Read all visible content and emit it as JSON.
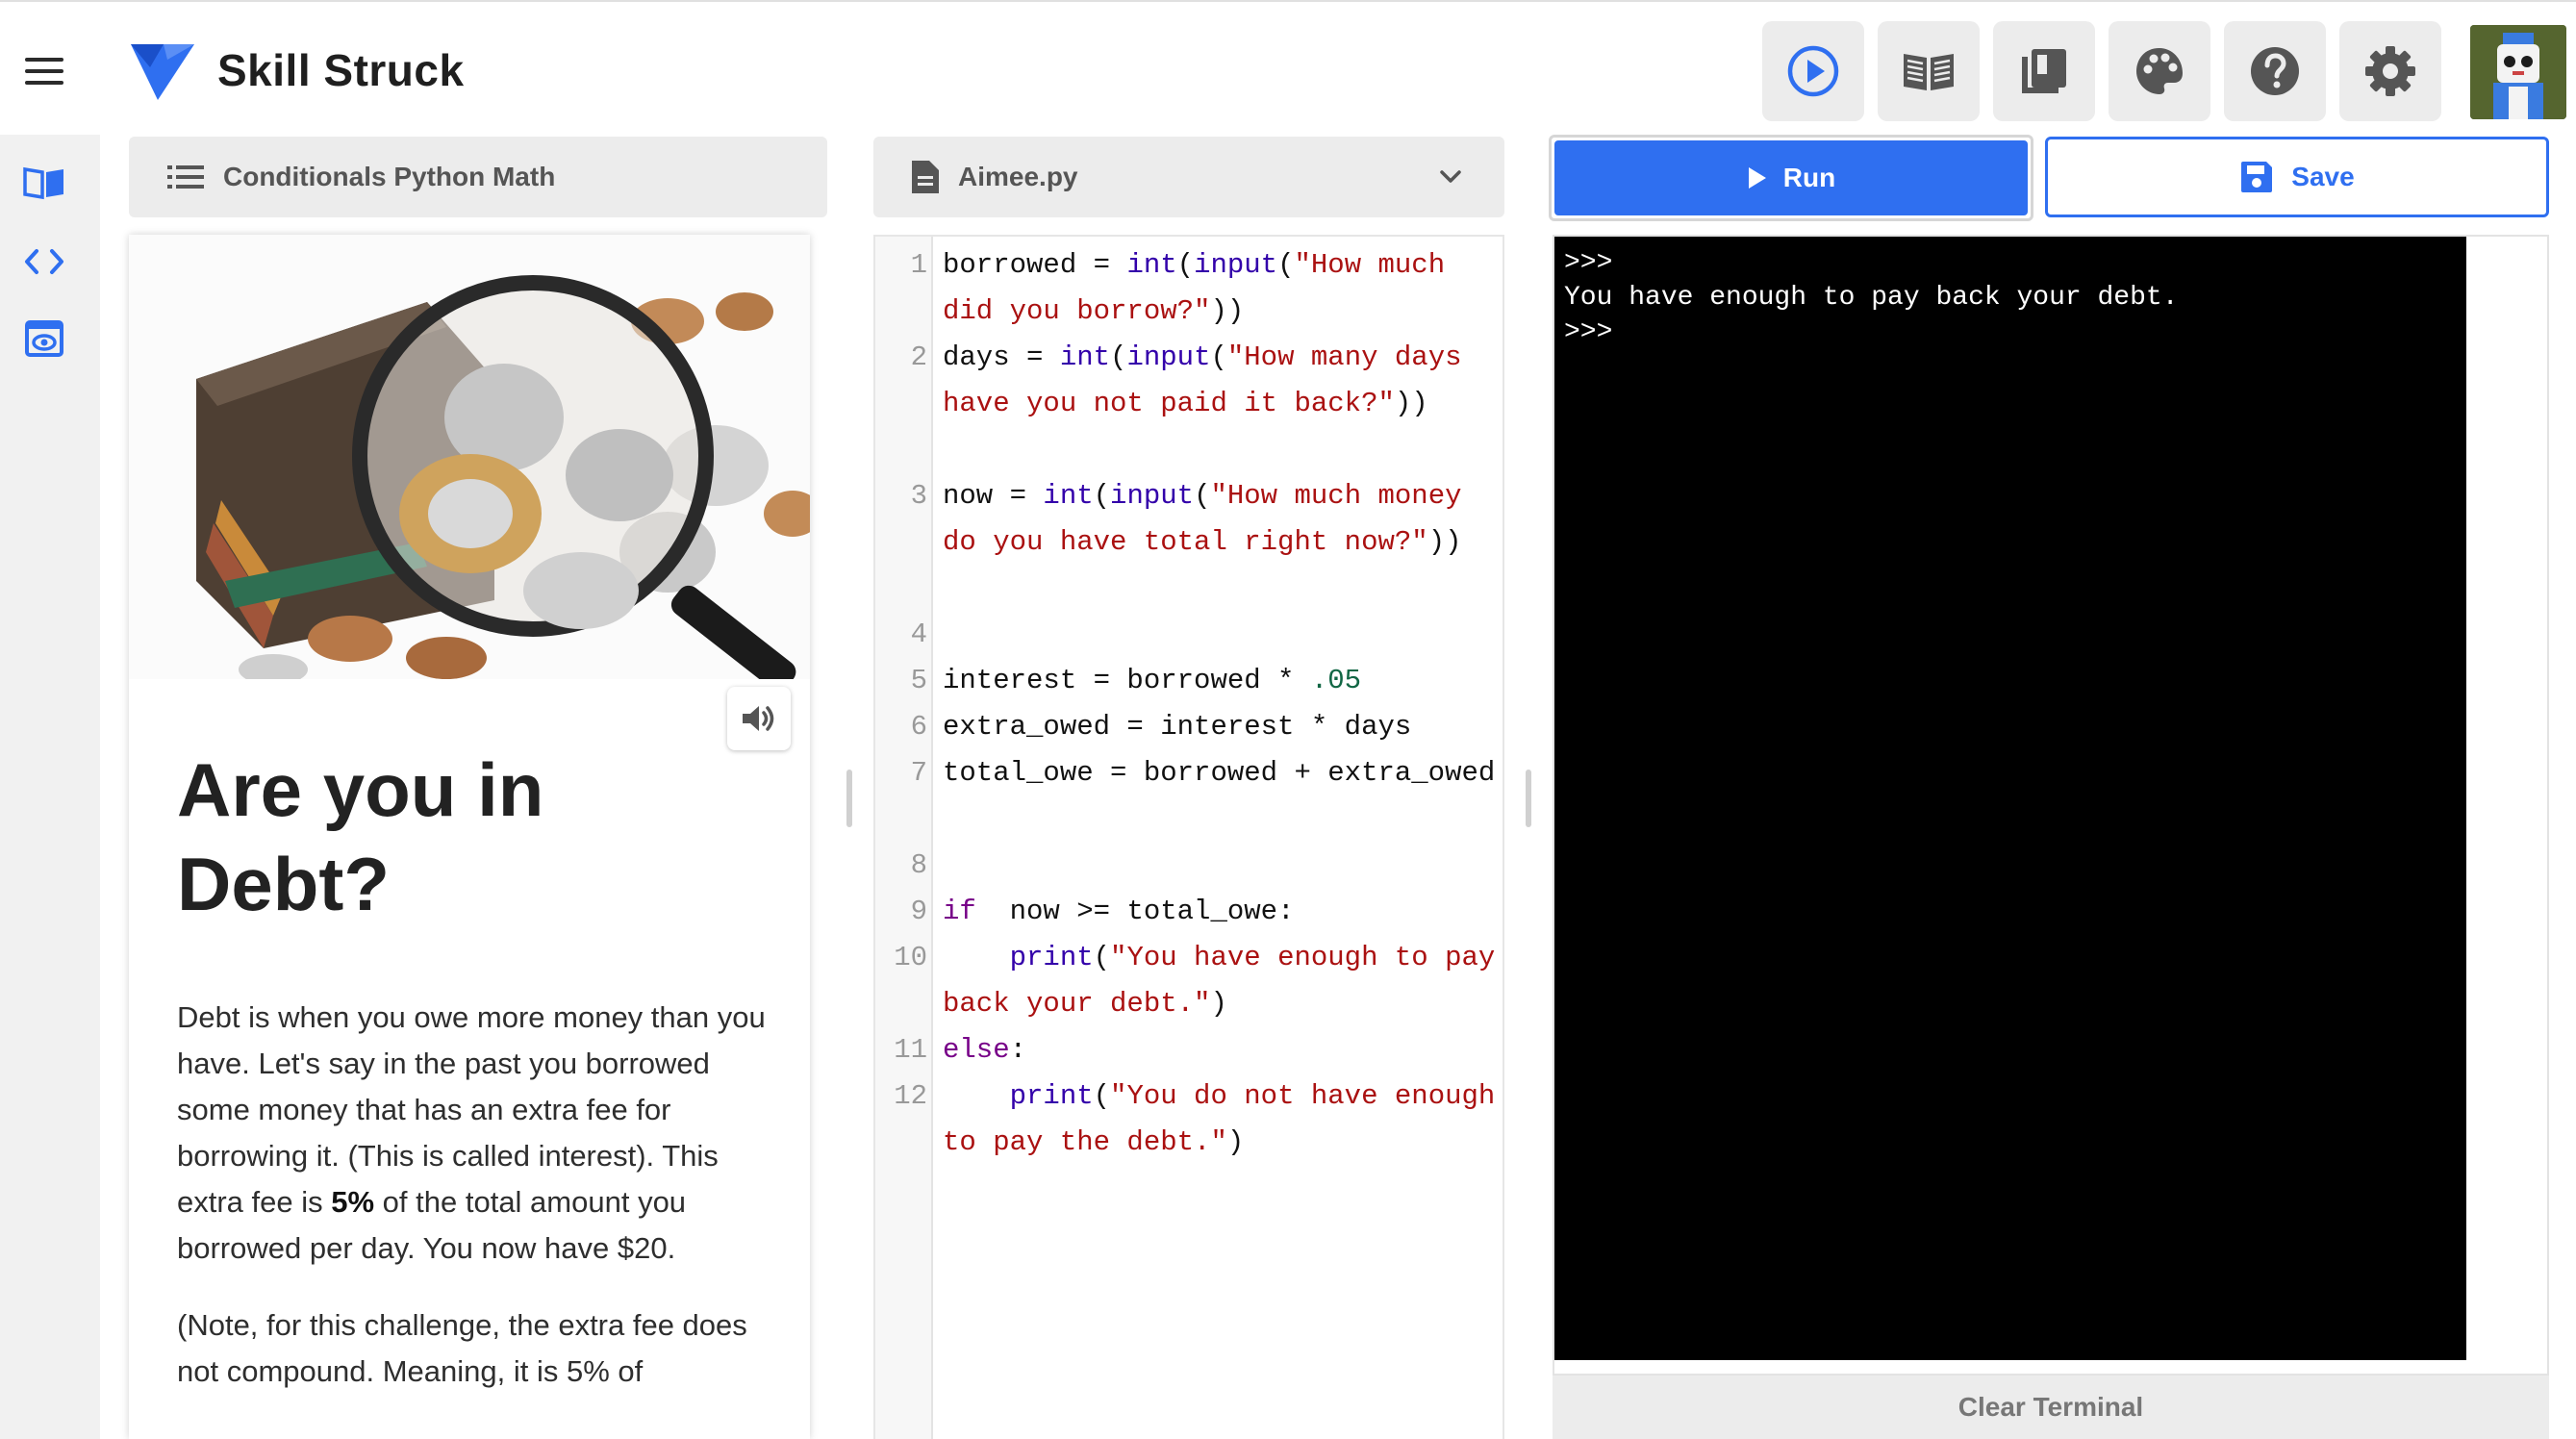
{
  "app": {
    "name": "Skill Struck",
    "brand_color": "#2f6ff0"
  },
  "toolbar": {
    "buttons": [
      {
        "icon": "play-circle-icon"
      },
      {
        "icon": "book-open-icon"
      },
      {
        "icon": "library-icon"
      },
      {
        "icon": "palette-icon"
      },
      {
        "icon": "help-icon"
      },
      {
        "icon": "settings-gear-icon"
      }
    ]
  },
  "rail": {
    "items": [
      {
        "icon": "lesson-book-icon"
      },
      {
        "icon": "code-brackets-icon"
      },
      {
        "icon": "preview-eye-icon"
      }
    ]
  },
  "lesson": {
    "header_label": "Conditionals Python Math",
    "title": "Are you in Debt?",
    "paragraph1_before": "Debt is when you owe more money than you have. Let's say in the past you borrowed some money that has an extra fee for borrowing it. (This is called interest). This extra fee is ",
    "paragraph1_bold": "5%",
    "paragraph1_after": " of the total amount you borrowed per day. You now have $20.",
    "paragraph2": "(Note, for this challenge, the extra fee does not compound. Meaning, it is 5% of"
  },
  "editor": {
    "file_name": "Aimee.py",
    "lines": [
      {
        "n": "1",
        "tokens": [
          [
            "",
            "borrowed = "
          ],
          [
            "bi",
            "int"
          ],
          [
            "",
            "("
          ],
          [
            "bi",
            "input"
          ],
          [
            "",
            "("
          ],
          [
            "str",
            "\"How much did you borrow?\""
          ],
          [
            "",
            "))"
          ]
        ]
      },
      {
        "n": "2",
        "tokens": [
          [
            "",
            "days = "
          ],
          [
            "bi",
            "int"
          ],
          [
            "",
            "("
          ],
          [
            "bi",
            "input"
          ],
          [
            "",
            "("
          ],
          [
            "str",
            "\"How many days have you not paid it back?\""
          ],
          [
            "",
            "))"
          ]
        ]
      },
      {
        "n": "3",
        "tokens": [
          [
            "",
            "now = "
          ],
          [
            "bi",
            "int"
          ],
          [
            "",
            "("
          ],
          [
            "bi",
            "input"
          ],
          [
            "",
            "("
          ],
          [
            "str",
            "\"How much money do you have total right now?\""
          ],
          [
            "",
            "))"
          ]
        ]
      },
      {
        "n": "4",
        "tokens": []
      },
      {
        "n": "5",
        "tokens": [
          [
            "",
            "interest = borrowed * "
          ],
          [
            "num",
            ".05"
          ]
        ]
      },
      {
        "n": "6",
        "tokens": [
          [
            "",
            "extra_owed = interest * days"
          ]
        ]
      },
      {
        "n": "7",
        "tokens": [
          [
            "",
            "total_owe = borrowed + extra_owed"
          ]
        ]
      },
      {
        "n": "8",
        "tokens": []
      },
      {
        "n": "9",
        "tokens": [
          [
            "kw",
            "if"
          ],
          [
            "",
            "  now >= total_owe:"
          ]
        ]
      },
      {
        "n": "10",
        "tokens": [
          [
            "",
            "    "
          ],
          [
            "bi",
            "print"
          ],
          [
            "",
            "("
          ],
          [
            "str",
            "\"You have enough to pay back your debt.\""
          ],
          [
            "",
            ")"
          ]
        ]
      },
      {
        "n": "11",
        "tokens": [
          [
            "kw",
            "else"
          ],
          [
            "",
            ":"
          ]
        ]
      },
      {
        "n": "12",
        "tokens": [
          [
            "",
            "    "
          ],
          [
            "bi",
            "print"
          ],
          [
            "",
            "("
          ],
          [
            "str",
            "\"You do not have enough to pay the debt.\""
          ],
          [
            "",
            ")"
          ]
        ]
      }
    ]
  },
  "actions": {
    "run_label": "Run",
    "save_label": "Save",
    "clear_terminal_label": "Clear Terminal"
  },
  "terminal": {
    "lines": [
      ">>>",
      "You have enough to pay back your debt.",
      ">>>"
    ]
  }
}
